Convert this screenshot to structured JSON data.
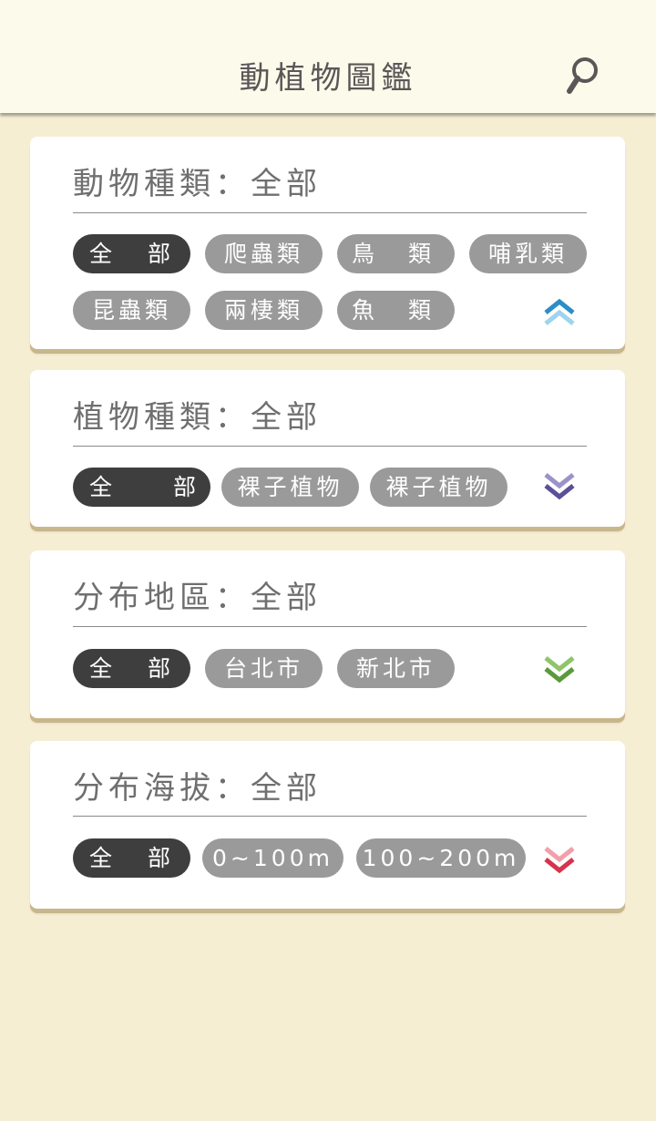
{
  "app": {
    "title": "動植物圖鑑"
  },
  "colors": {
    "background": "#f5eed3",
    "header": "#fcfaea",
    "card_shadow": "#c8b68c",
    "chip_active": "#3e3e3e",
    "chip_inactive": "#9a9a9a",
    "animal_chevron": [
      "#2c8ec6",
      "#9fd4ee"
    ],
    "plant_chevron": [
      "#9b93c8",
      "#5b4f98"
    ],
    "region_chevron": [
      "#8fc56a",
      "#5a9a3a"
    ],
    "altitude_chevron": [
      "#f2a0a8",
      "#d6334e"
    ]
  },
  "filters": {
    "animal": {
      "heading": "動物種類：全部",
      "chips": [
        {
          "a": "全",
          "b": "部"
        },
        {
          "label": "爬蟲類"
        },
        {
          "a": "鳥",
          "b": "類"
        },
        {
          "label": "哺乳類"
        },
        {
          "label": "昆蟲類"
        },
        {
          "label": "兩棲類"
        },
        {
          "a": "魚",
          "b": "類"
        }
      ],
      "chevron_icon": "chevron-up-double-icon"
    },
    "plant": {
      "heading": "植物種類：全部",
      "chips": [
        {
          "a": "全",
          "b": "部"
        },
        {
          "label": "裸子植物"
        },
        {
          "label": "裸子植物"
        }
      ],
      "chevron_icon": "chevron-down-double-icon"
    },
    "region": {
      "heading": "分布地區：全部",
      "chips": [
        {
          "a": "全",
          "b": "部"
        },
        {
          "label": "台北市"
        },
        {
          "label": "新北市"
        }
      ],
      "chevron_icon": "chevron-down-double-icon"
    },
    "altitude": {
      "heading": "分布海拔：全部",
      "chips": [
        {
          "a": "全",
          "b": "部"
        },
        {
          "label": "0~100m"
        },
        {
          "label": "100~200m"
        }
      ],
      "chevron_icon": "chevron-down-double-icon"
    }
  }
}
